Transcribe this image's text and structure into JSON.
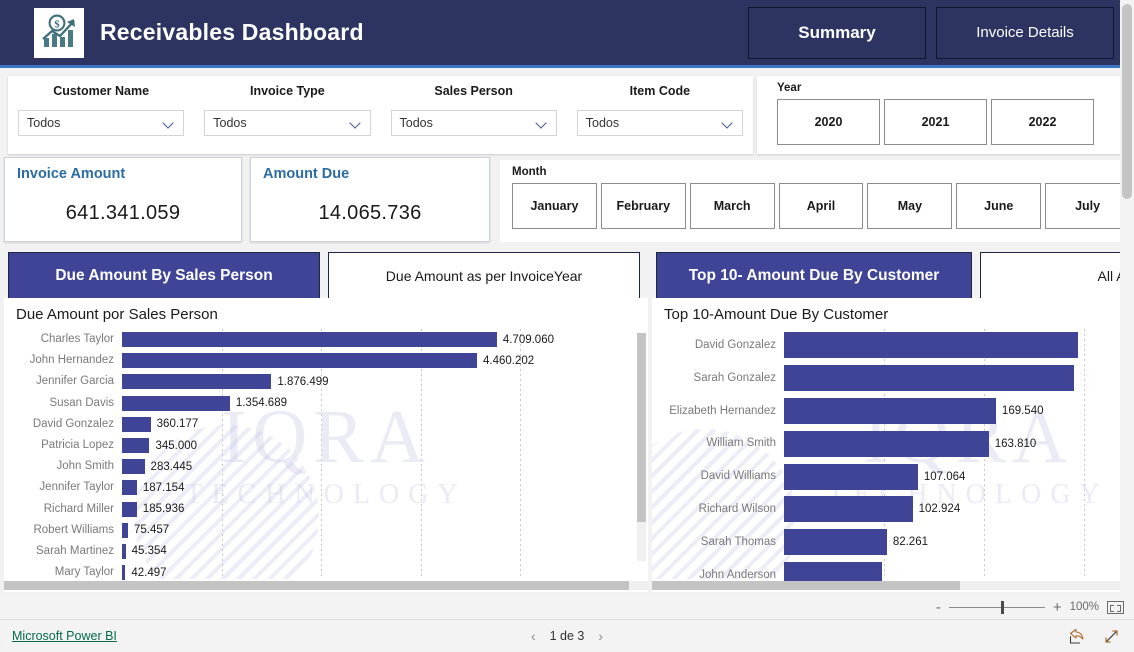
{
  "header": {
    "title": "Receivables Dashboard",
    "logo_icon": "growth-chart-dollar-icon",
    "tabs": [
      {
        "label": "Summary",
        "active": true
      },
      {
        "label": "Invoice Details",
        "active": false
      }
    ]
  },
  "filters": [
    {
      "label": "Customer Name",
      "value": "Todos"
    },
    {
      "label": "Invoice Type",
      "value": "Todos"
    },
    {
      "label": "Sales Person",
      "value": "Todos"
    },
    {
      "label": "Item Code",
      "value": "Todos"
    }
  ],
  "year_slicer": {
    "title": "Year",
    "options": [
      "2020",
      "2021",
      "2022"
    ]
  },
  "month_slicer": {
    "title": "Month",
    "options": [
      "January",
      "February",
      "March",
      "April",
      "May",
      "June",
      "July"
    ]
  },
  "kpis": [
    {
      "title": "Invoice Amount",
      "value": "641.341.059"
    },
    {
      "title": "Amount Due",
      "value": "14.065.736"
    }
  ],
  "left_visual": {
    "tabs": [
      {
        "label": "Due Amount By Sales Person",
        "active": true
      },
      {
        "label": "Due Amount as per InvoiceYear",
        "active": false
      }
    ],
    "title": "Due Amount por Sales Person"
  },
  "right_visual": {
    "tabs": [
      {
        "label": "Top 10- Amount Due By Customer",
        "active": true
      },
      {
        "label": "All Amount D",
        "active": false
      }
    ],
    "title": "Top 10-Amount Due By Customer"
  },
  "watermark": {
    "main": "IQRA",
    "sub": "TECHNOLOGY"
  },
  "zoom_bar": {
    "minus": "-",
    "plus": "+",
    "percent": "100%",
    "fit_icon": "fit-to-page-icon"
  },
  "footer": {
    "brand": "Microsoft Power BI",
    "prev_icon": "chevron-left-icon",
    "next_icon": "chevron-right-icon",
    "page_label": "1 de 3",
    "share_icon": "share-icon",
    "fullscreen_icon": "fullscreen-icon"
  },
  "chart_data": [
    {
      "type": "bar",
      "orientation": "horizontal",
      "id": "due-amount-by-sales-person",
      "title": "Due Amount por Sales Person",
      "xlabel": "",
      "ylabel": "",
      "grid": true,
      "xlim": [
        0,
        5000000
      ],
      "categories": [
        "Charles Taylor",
        "John Hernandez",
        "Jennifer Garcia",
        "Susan Davis",
        "David Gonzalez",
        "Patricia Lopez",
        "John Smith",
        "Jennifer Taylor",
        "Richard Miller",
        "Robert Williams",
        "Sarah Martinez",
        "Mary Taylor"
      ],
      "values": [
        4709060,
        4460202,
        1876499,
        1354689,
        360177,
        345000,
        283445,
        187154,
        185936,
        75457,
        45354,
        42497
      ],
      "labels": [
        "4.709.060",
        "4.460.202",
        "1.876.499",
        "1.354.689",
        "360.177",
        "345.000",
        "283.445",
        "187.154",
        "185.936",
        "75.457",
        "45.354",
        "42.497"
      ],
      "visible_rows": 11,
      "truncated_last_row": true
    },
    {
      "type": "bar",
      "orientation": "horizontal",
      "id": "top-10-amount-due-by-customer",
      "title": "Top 10-Amount Due By Customer",
      "xlabel": "",
      "ylabel": "",
      "grid": true,
      "xlim": [
        0,
        240000
      ],
      "categories": [
        "David Gonzalez",
        "Sarah Gonzalez",
        "Elizabeth Hernandez",
        "William Smith",
        "David Williams",
        "Richard Wilson",
        "Sarah Thomas",
        "John Anderson"
      ],
      "values": [
        235000,
        232000,
        169540,
        163810,
        107064,
        102924,
        82261,
        78000
      ],
      "labels": [
        "",
        "",
        "169.540",
        "163.810",
        "107.064",
        "102.924",
        "82.261",
        ""
      ],
      "visible_rows": 7,
      "truncated_last_row": true,
      "note": "Top two bars extend past the visible clipped viewport; their value labels are off-screen."
    }
  ],
  "colors": {
    "header_navy": "#2d3462",
    "header_underline": "#3a74c4",
    "bar_indigo": "#3f4496",
    "kpi_title_blue": "#2b6ca3",
    "page_bg": "#f2f2f2",
    "footer_link_green": "#076b4f"
  }
}
